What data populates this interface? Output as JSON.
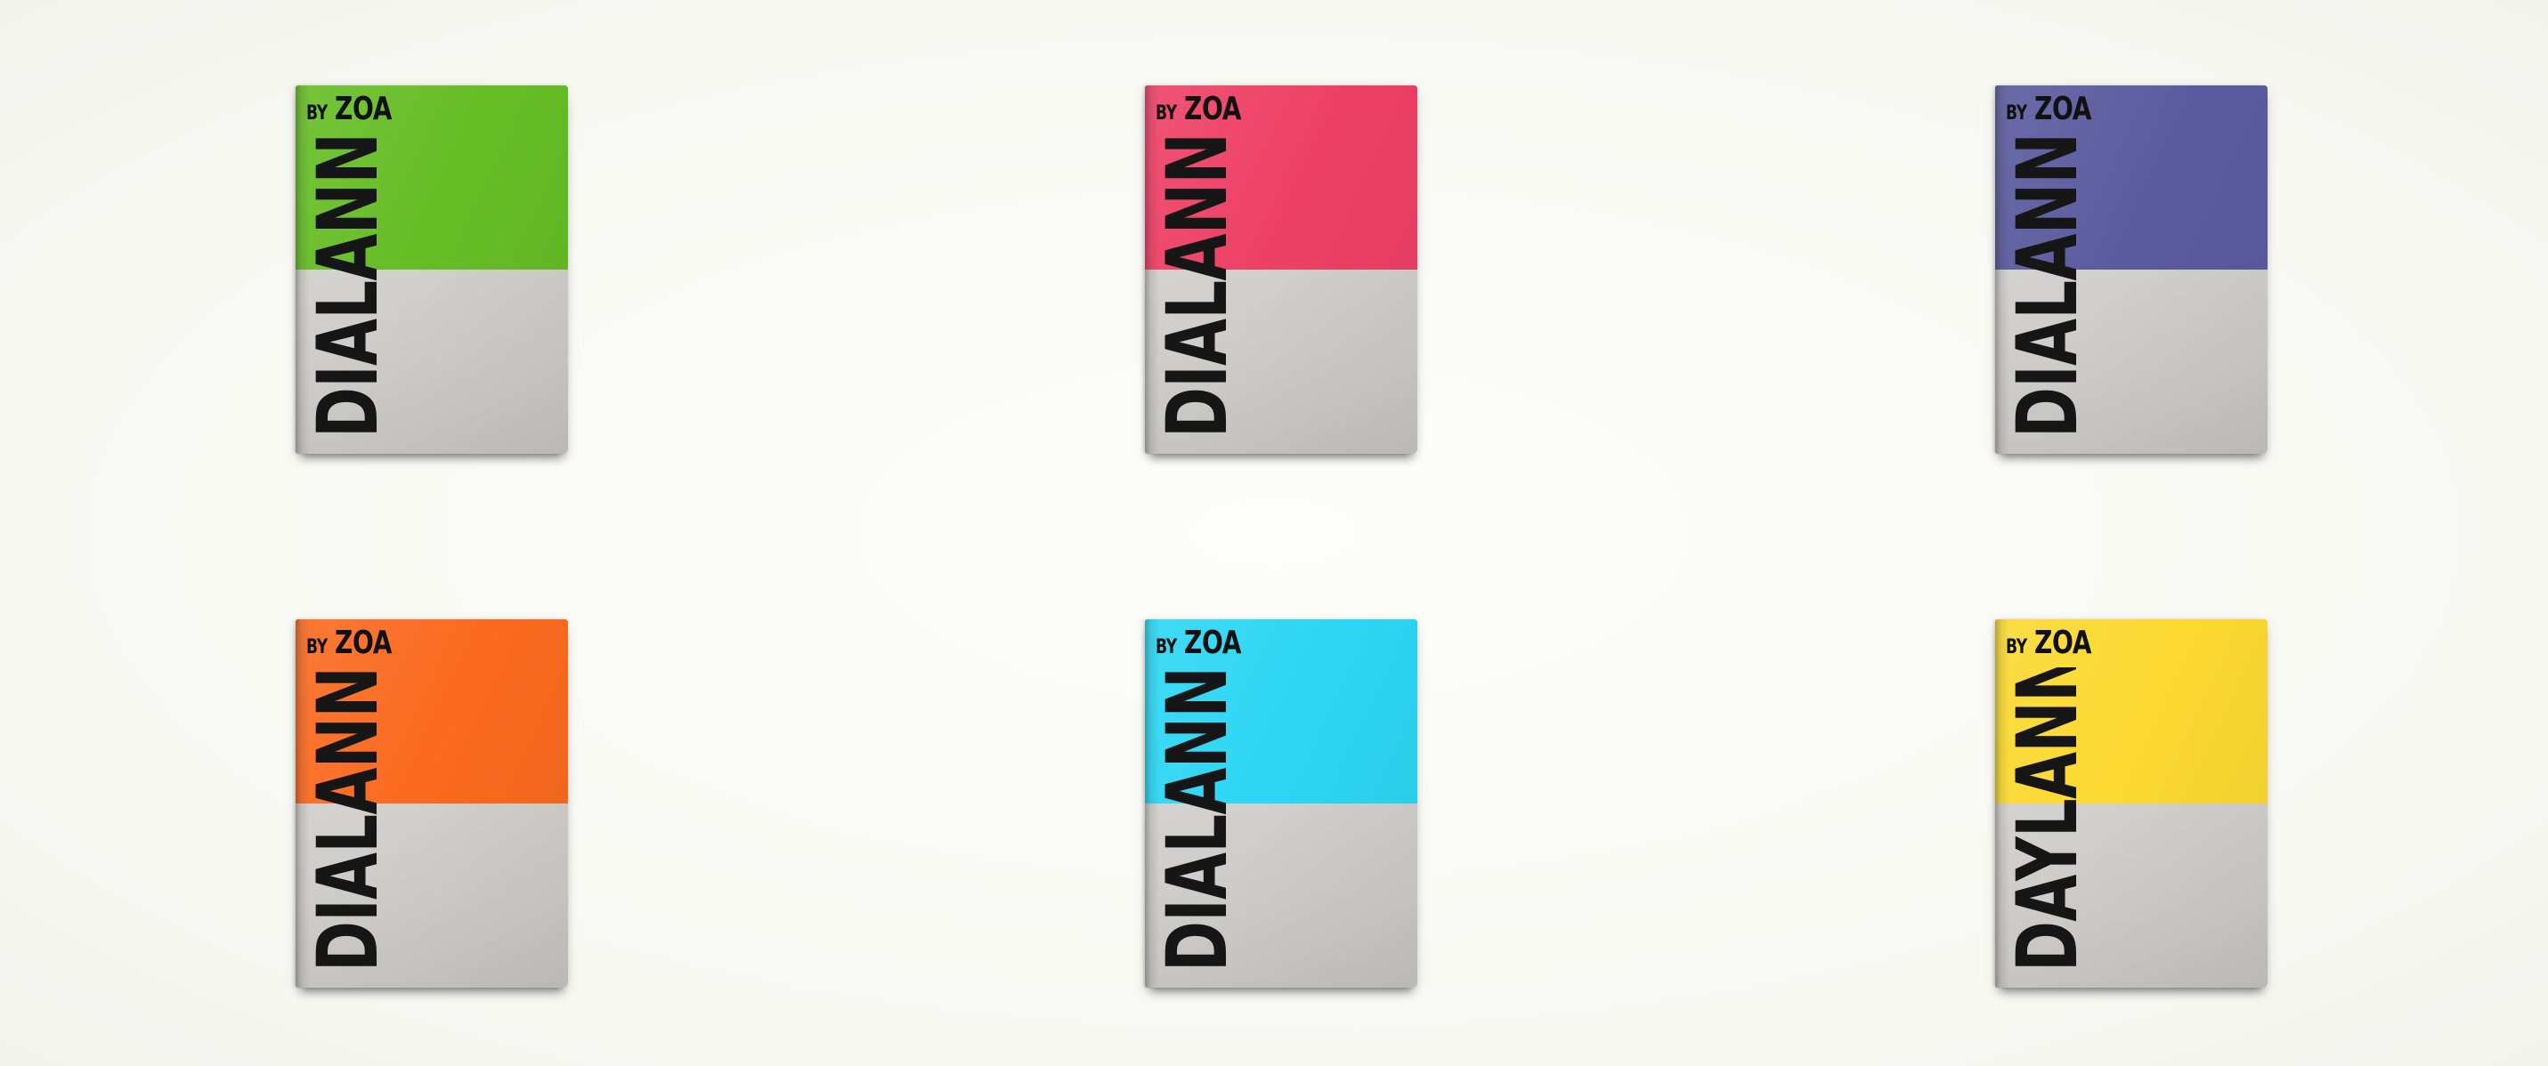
{
  "booklets": [
    {
      "byline_prefix": "BY",
      "byline_name": "ZOA",
      "title": "DIALANN",
      "cover_color": "#66bd25"
    },
    {
      "byline_prefix": "BY",
      "byline_name": "ZOA",
      "title": "DIALANN",
      "cover_color": "#ee4065"
    },
    {
      "byline_prefix": "BY",
      "byline_name": "ZOA",
      "title": "DIALANN",
      "cover_color": "#5b5b9f"
    },
    {
      "byline_prefix": "BY",
      "byline_name": "ZOA",
      "title": "DIALANN",
      "cover_color": "#fa6a1f"
    },
    {
      "byline_prefix": "BY",
      "byline_name": "ZOA",
      "title": "DIALANN",
      "cover_color": "#2cd6f4"
    },
    {
      "byline_prefix": "BY",
      "byline_name": "ZOA",
      "title": "DAYLANN",
      "cover_color": "#fbd930"
    }
  ],
  "colors": {
    "background": "#fafaf6",
    "paper_grey": "#cecccA",
    "ink": "#141414"
  }
}
